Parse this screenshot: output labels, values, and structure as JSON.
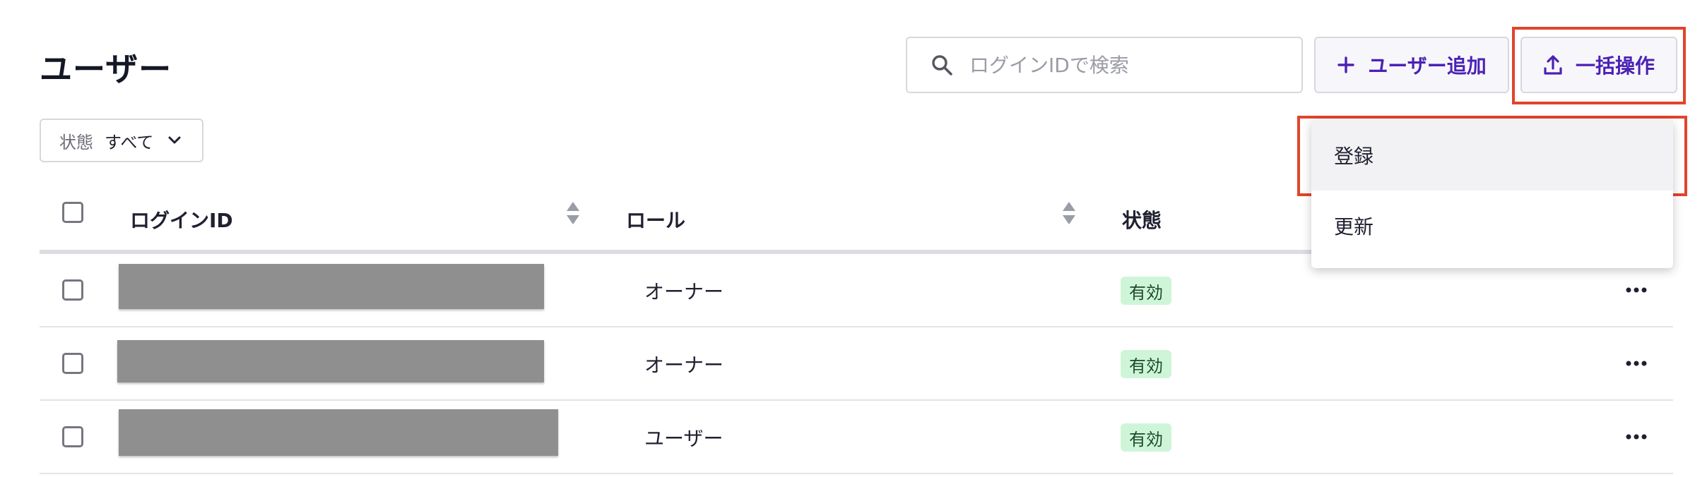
{
  "header": {
    "title": "ユーザー",
    "search": {
      "placeholder": "ログインIDで検索",
      "value": ""
    },
    "add_user_label": "ユーザー追加",
    "bulk_label": "一括操作"
  },
  "filter": {
    "label": "状態",
    "value": "すべて"
  },
  "table": {
    "columns": {
      "login_id": "ログインID",
      "role": "ロール",
      "status": "状態"
    },
    "rows": [
      {
        "role": "オーナー",
        "status": "有効"
      },
      {
        "role": "オーナー",
        "status": "有効"
      },
      {
        "role": "ユーザー",
        "status": "有効"
      }
    ]
  },
  "dropdown": {
    "items": [
      {
        "label": "登録"
      },
      {
        "label": "更新"
      }
    ]
  },
  "colors": {
    "accent": "#4b21b5",
    "highlight": "#e0452b",
    "badge_bg": "#cff5d9"
  },
  "icons": [
    "search-icon",
    "plus-icon",
    "upload-icon",
    "chevron-down-icon",
    "sort-icon",
    "more-horizontal-icon"
  ]
}
